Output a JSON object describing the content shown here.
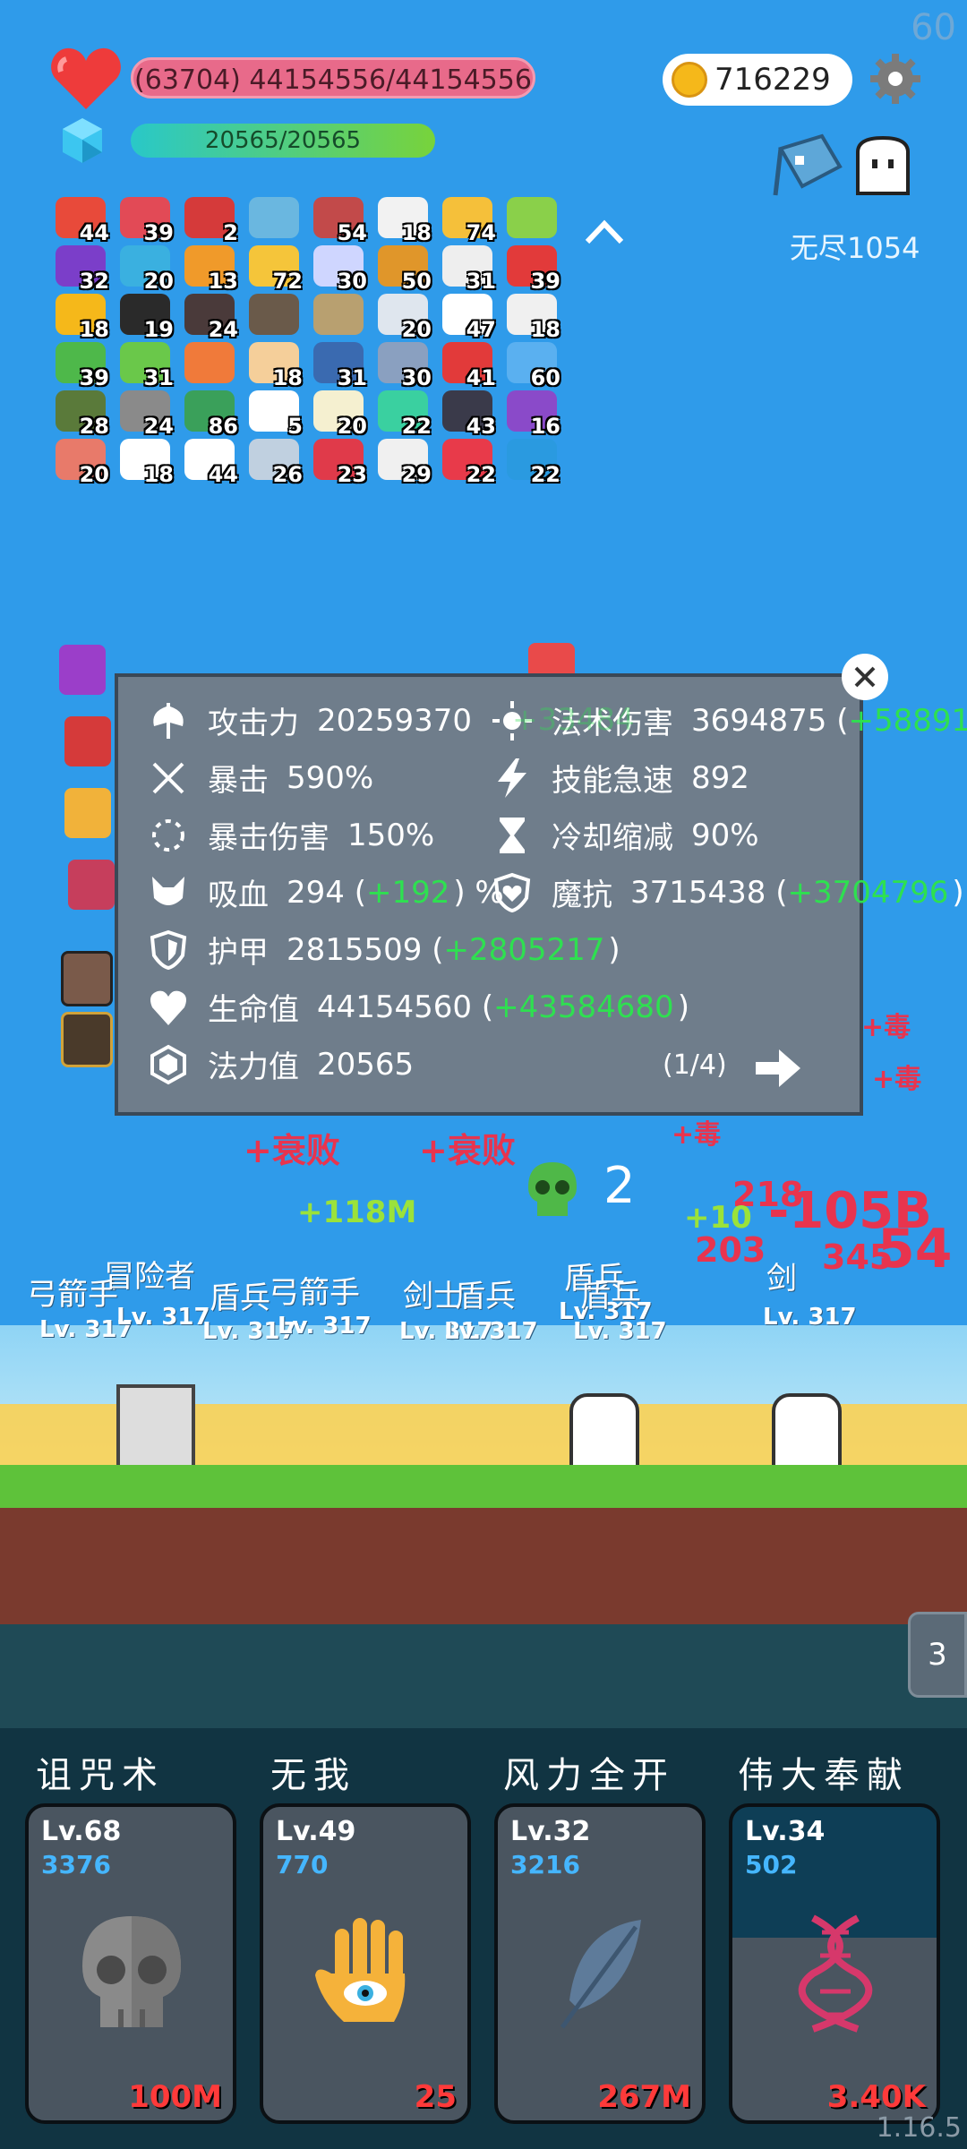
{
  "hud": {
    "fps": "60",
    "hp_text": "(63704) 44154556/44154556",
    "mp_text": "20565/20565",
    "coins": "716229",
    "endless_label": "无尽1054",
    "version": "1.16.5"
  },
  "items": [
    {
      "icon": "apple-icon",
      "count": "44"
    },
    {
      "icon": "watermelon-icon",
      "count": "39"
    },
    {
      "icon": "magnet-icon",
      "count": "2"
    },
    {
      "icon": "magnifier-icon",
      "count": ""
    },
    {
      "icon": "jar-icon",
      "count": "54"
    },
    {
      "icon": "clipboard-icon",
      "count": "18"
    },
    {
      "icon": "sun-icon",
      "count": "74"
    },
    {
      "icon": "book-icon",
      "count": ""
    },
    {
      "icon": "hat-icon",
      "count": "32"
    },
    {
      "icon": "scroll-icon",
      "count": "20"
    },
    {
      "icon": "paper-scroll-icon",
      "count": "13"
    },
    {
      "icon": "crown-icon",
      "count": "72"
    },
    {
      "icon": "eraser-icon",
      "count": "30"
    },
    {
      "icon": "tome-icon",
      "count": "50"
    },
    {
      "icon": "cards-icon",
      "count": "31"
    },
    {
      "icon": "mushroom-icon",
      "count": "39"
    },
    {
      "icon": "sunflower-icon",
      "count": "18"
    },
    {
      "icon": "cauldron-icon",
      "count": "19"
    },
    {
      "icon": "tombstone-icon",
      "count": "24"
    },
    {
      "icon": "mortar-icon",
      "count": ""
    },
    {
      "icon": "potion-icon",
      "count": ""
    },
    {
      "icon": "envelope-icon",
      "count": "20"
    },
    {
      "icon": "flower-icon",
      "count": "47"
    },
    {
      "icon": "dice-icon",
      "count": "18"
    },
    {
      "icon": "goblin-icon",
      "count": "39"
    },
    {
      "icon": "lime-icon",
      "count": "31"
    },
    {
      "icon": "torch-icon",
      "count": ""
    },
    {
      "icon": "hand-icon",
      "count": "18"
    },
    {
      "icon": "mustache-icon",
      "count": "31"
    },
    {
      "icon": "shield-icon",
      "count": "30"
    },
    {
      "icon": "sock-icon",
      "count": "41"
    },
    {
      "icon": "star-card-icon",
      "count": "60"
    },
    {
      "icon": "grenade-icon",
      "count": "28"
    },
    {
      "icon": "compass-icon",
      "count": "24"
    },
    {
      "icon": "cash-icon",
      "count": "86"
    },
    {
      "icon": "chat-icon",
      "count": "5"
    },
    {
      "icon": "egg-icon",
      "count": "20"
    },
    {
      "icon": "spirit-icon",
      "count": "22"
    },
    {
      "icon": "bat-icon",
      "count": "43"
    },
    {
      "icon": "purple-shield-icon",
      "count": "16"
    },
    {
      "icon": "meat-icon",
      "count": "20"
    },
    {
      "icon": "pill-icon",
      "count": "18"
    },
    {
      "icon": "ghost-icon",
      "count": "44"
    },
    {
      "icon": "bulb-icon",
      "count": "26"
    },
    {
      "icon": "strawberry-icon",
      "count": "23"
    },
    {
      "icon": "cloud-icon",
      "count": "29"
    },
    {
      "icon": "heart-item-icon",
      "count": "22"
    },
    {
      "icon": "speech-icon",
      "count": "22"
    }
  ],
  "stats": [
    {
      "icon": "axe-icon",
      "label": "攻击力",
      "value": "20259370",
      "bonus": "",
      "pct": ""
    },
    {
      "icon": "crit-icon",
      "label": "暴击",
      "value": "590%",
      "bonus": "",
      "pct": ""
    },
    {
      "icon": "crit-damage-icon",
      "label": "暴击伤害",
      "value": "150%",
      "bonus": "",
      "pct": ""
    },
    {
      "icon": "lifesteal-icon",
      "label": "吸血",
      "value": "294 (",
      "bonus": "+192",
      "pct": ") %"
    },
    {
      "icon": "armor-icon",
      "label": "护甲",
      "value": "2815509 (",
      "bonus": "+2805217",
      "pct": ")"
    },
    {
      "icon": "heart-stat-icon",
      "label": "生命值",
      "value": "44154560 (",
      "bonus": "+43584680",
      "pct": ")"
    },
    {
      "icon": "mana-icon",
      "label": "法力值",
      "value": "20565",
      "bonus": "",
      "pct": ""
    }
  ],
  "stats_right": [
    {
      "icon": "magic-sun-icon",
      "label": "法术伤害",
      "value": "3694875 (",
      "bonus": "+58891",
      "pct": ""
    },
    {
      "icon": "lightning-icon",
      "label": "技能急速",
      "value": "892",
      "bonus": "",
      "pct": ""
    },
    {
      "icon": "hourglass-icon",
      "label": "冷却缩减",
      "value": "90%",
      "bonus": "",
      "pct": ""
    },
    {
      "icon": "magic-shield-icon",
      "label": "魔抗",
      "value": "3715438 (",
      "bonus": "+3704796",
      "pct": ")"
    }
  ],
  "modal": {
    "pager": "(1/4)",
    "attack_bonus": "+33484"
  },
  "battle": {
    "kill_count": "2",
    "floating": [
      {
        "text": "+衰败",
        "color": "#e8344e"
      },
      {
        "text": "+衰败",
        "color": "#e8344e"
      },
      {
        "text": "+118M",
        "color": "#9be23a"
      },
      {
        "text": "+毒",
        "color": "#e8344e"
      },
      {
        "text": "+毒",
        "color": "#e8344e"
      },
      {
        "text": "+毒",
        "color": "#e8344e"
      },
      {
        "text": "218",
        "color": "#e8344e"
      },
      {
        "text": "-105B",
        "color": "#e8344e"
      },
      {
        "text": "+10",
        "color": "#9be23a"
      },
      {
        "text": "203",
        "color": "#e8344e"
      },
      {
        "text": "345",
        "color": "#e8344e"
      },
      {
        "text": "54",
        "color": "#e8344e"
      }
    ],
    "units": [
      {
        "name": "弓箭手",
        "lv": "Lv. 317"
      },
      {
        "name": "冒险者",
        "lv": "Lv. 317"
      },
      {
        "name": "盾兵",
        "lv": "Lv. 317"
      },
      {
        "name": "弓箭手",
        "lv": "Lv. 317"
      },
      {
        "name": "剑士",
        "lv": "Lv. 317"
      },
      {
        "name": "盾兵",
        "lv": "Lv. 317"
      },
      {
        "name": "盾兵",
        "lv": "Lv. 317"
      },
      {
        "name": "盾兵",
        "lv": "Lv. 317"
      },
      {
        "name": "剑",
        "lv": "Lv. 317"
      }
    ],
    "wave_tab": "3"
  },
  "skills": [
    {
      "name": "诅咒术",
      "level": "Lv.68",
      "number": "3376",
      "cost": "100M",
      "icon": "skull-icon"
    },
    {
      "name": "无我",
      "level": "Lv.49",
      "number": "770",
      "cost": "25",
      "icon": "eye-hand-icon"
    },
    {
      "name": "风力全开",
      "level": "Lv.32",
      "number": "3216",
      "cost": "267M",
      "icon": "feather-icon"
    },
    {
      "name": "伟大奉献",
      "level": "Lv.34",
      "number": "502",
      "cost": "3.40K",
      "icon": "dna-icon"
    }
  ],
  "colors": {
    "sky": "#2f9bea",
    "hp": "#e86a8a",
    "mp_start": "#29c8c8",
    "mp_end": "#78d33b",
    "bonus": "#2ee050",
    "cost": "#ff3a3a",
    "skill_number": "#45b6ff"
  }
}
